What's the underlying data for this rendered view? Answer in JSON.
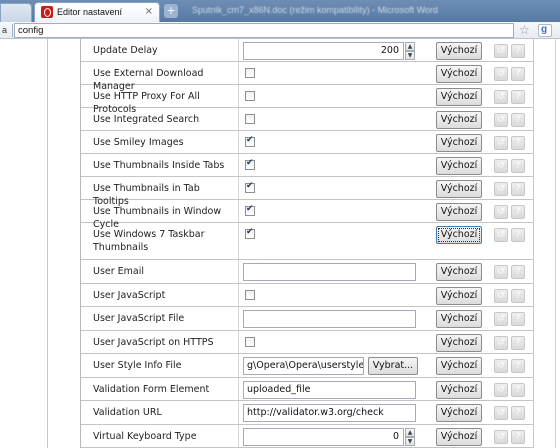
{
  "browser": {
    "tab_prev_label": "a",
    "active_tab_title": "Editor nastavení",
    "tab_close": "×",
    "new_tab": "+",
    "window_title": "Sputnik_cm7_x86N.doc (režim kompatibility) - Microsoft Word",
    "address_left": "a",
    "address": "config",
    "star_icon": "☆",
    "search_engine": "g"
  },
  "labels": {
    "default_button": "Výchozí",
    "choose_button": "Vybrat...",
    "reset_glyph": "↺",
    "help_glyph": "?"
  },
  "rows": [
    {
      "name": "Update Delay",
      "type": "number",
      "value": "200"
    },
    {
      "name": "Use External Download Manager",
      "type": "checkbox",
      "checked": false
    },
    {
      "name": "Use HTTP Proxy For All Protocols",
      "type": "checkbox",
      "checked": false
    },
    {
      "name": "Use Integrated Search",
      "type": "checkbox",
      "checked": false
    },
    {
      "name": "Use Smiley Images",
      "type": "checkbox",
      "checked": true
    },
    {
      "name": "Use Thumbnails Inside Tabs",
      "type": "checkbox",
      "checked": true
    },
    {
      "name": "Use Thumbnails in Tab Tooltips",
      "type": "checkbox",
      "checked": true
    },
    {
      "name": "Use Thumbnails in Window Cycle",
      "type": "checkbox",
      "checked": true
    },
    {
      "name": "Use Windows 7 Taskbar Thumbnails",
      "type": "checkbox",
      "checked": true
    },
    {
      "name": "User Email",
      "type": "text",
      "value": ""
    },
    {
      "name": "User JavaScript",
      "type": "checkbox",
      "checked": false
    },
    {
      "name": "User JavaScript File",
      "type": "text",
      "value": ""
    },
    {
      "name": "User JavaScript on HTTPS",
      "type": "checkbox",
      "checked": false
    },
    {
      "name": "User Style Info File",
      "type": "file",
      "value": "g\\Opera\\Opera\\userstyle.ini"
    },
    {
      "name": "Validation Form Element",
      "type": "text",
      "value": "uploaded_file"
    },
    {
      "name": "Validation URL",
      "type": "text",
      "value": "http://validator.w3.org/check"
    },
    {
      "name": "Virtual Keyboard Type",
      "type": "number",
      "value": "0"
    }
  ]
}
